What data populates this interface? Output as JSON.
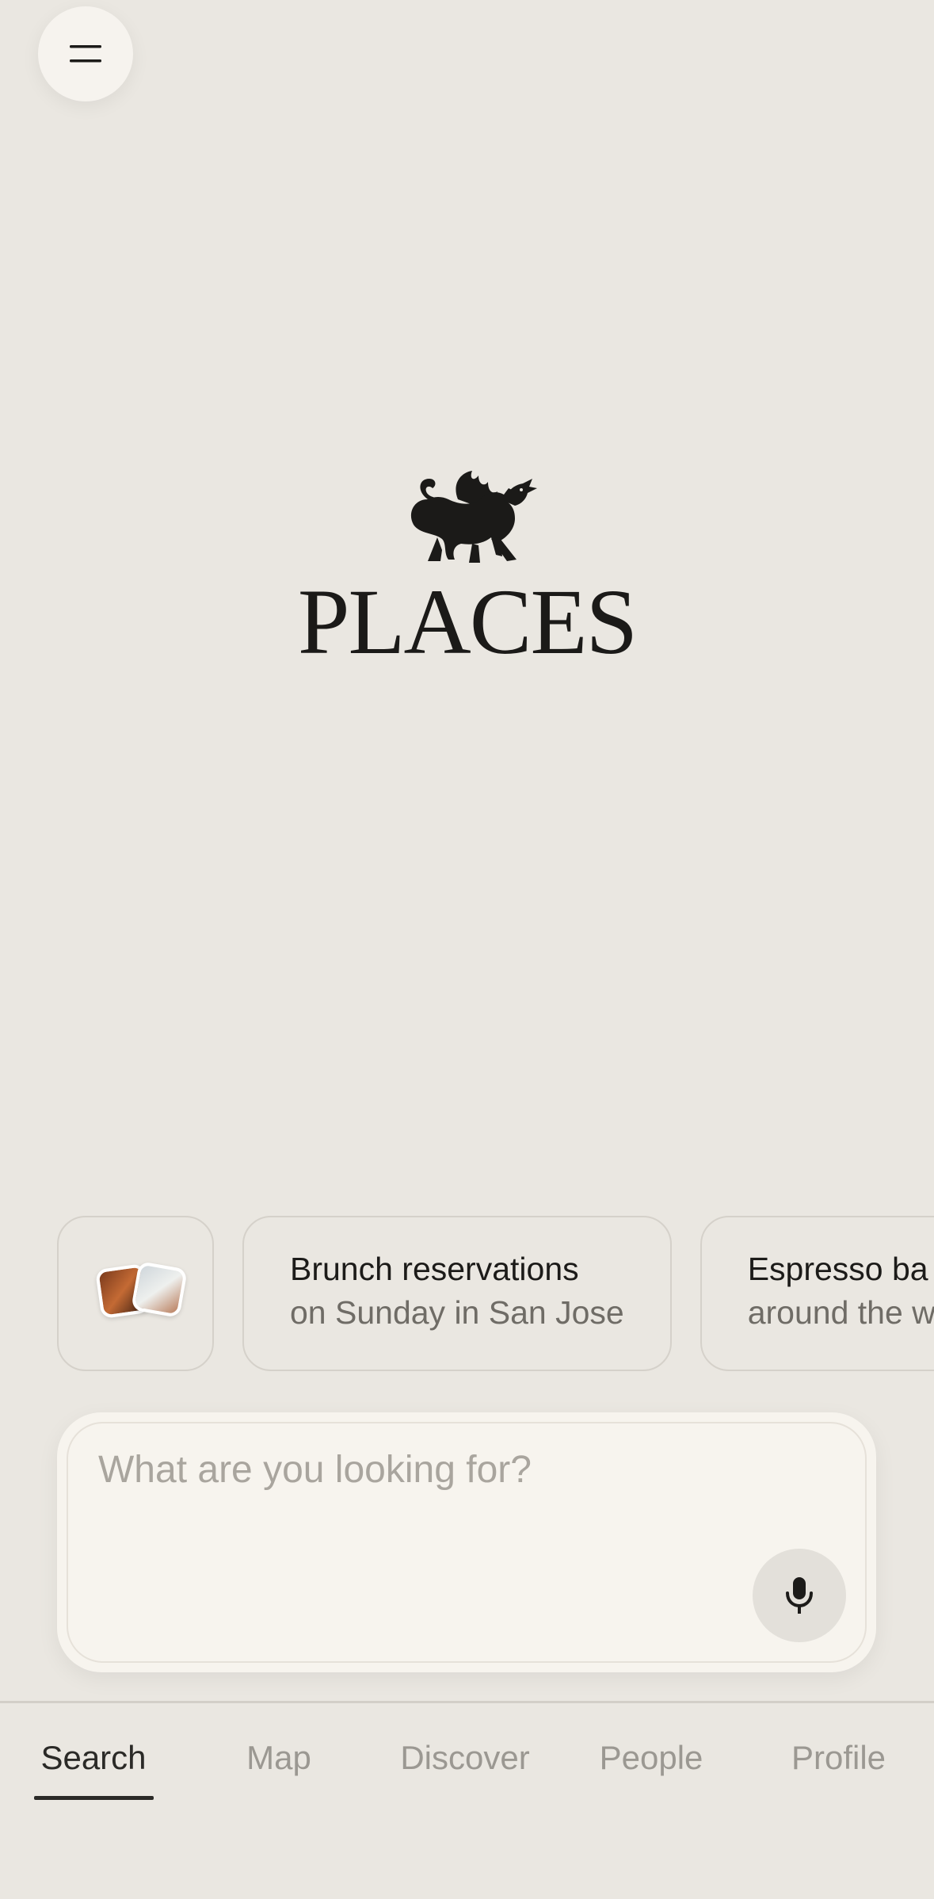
{
  "header": {
    "menu_icon": "hamburger-menu-icon"
  },
  "brand": {
    "name": "PLACES",
    "mark_icon": "dragon-logo-icon"
  },
  "suggestions": [
    {
      "type": "photos",
      "icon": "photo-stack-icon"
    },
    {
      "title": "Brunch reservations",
      "subtitle": "on Sunday in San Jose"
    },
    {
      "title": "Espresso ba",
      "subtitle": "around the w"
    }
  ],
  "search": {
    "placeholder": "What are you looking for?",
    "value": "",
    "mic_icon": "microphone-icon"
  },
  "tabs": [
    {
      "label": "Search",
      "active": true
    },
    {
      "label": "Map",
      "active": false
    },
    {
      "label": "Discover",
      "active": false
    },
    {
      "label": "People",
      "active": false
    },
    {
      "label": "Profile",
      "active": false
    }
  ],
  "colors": {
    "background": "#EAE7E1",
    "card": "#F7F4EE",
    "text": "#1C1B19",
    "muted": "#9B9892"
  }
}
